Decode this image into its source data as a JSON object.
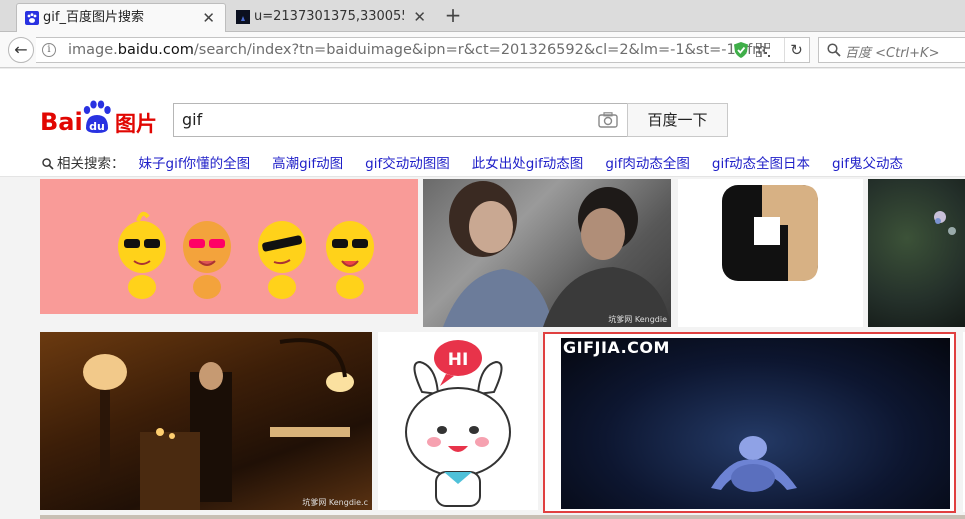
{
  "browser": {
    "tabs": [
      {
        "label": "gif_百度图片搜索",
        "close": "✕",
        "icon": "paw-icon"
      },
      {
        "label": "u=2137301375,330055...",
        "close": "✕",
        "icon": "image-thumb-icon"
      }
    ],
    "new_tab": "+",
    "back": "←",
    "info": "i",
    "url_prefix": "image.",
    "url_domain": "baidu.com",
    "url_path": "/search/index?tn=baiduimage&ipn=r&ct=201326592&cl=2&lm=-1&st=-1&fm",
    "reload": "↻",
    "search_placeholder": "百度 <Ctrl+K>"
  },
  "header": {
    "logo_bai": "Bai",
    "logo_du": "du",
    "logo_tupian": "图片",
    "query": "gif",
    "search_button": "百度一下",
    "related_label": "相关搜索：",
    "related_links": [
      "妹子gif你懂的全图",
      "高潮gif动图",
      "gif交动动图图",
      "此女出处gif动态图",
      "gif肉动态全图",
      "gif动态全图日本",
      "gif鬼父动态"
    ]
  },
  "results": {
    "speech_bubble": "HI",
    "brand_overlay": "GIFJIA.COM",
    "watermark_1": "坑爹网 Kengdie",
    "watermark_2": "坑爹网 Kengdie.c"
  },
  "colors": {
    "brand_red": "#e10602",
    "brand_blue": "#2932e1",
    "link_blue": "#1e1ec8",
    "selection_border": "#e04040"
  }
}
